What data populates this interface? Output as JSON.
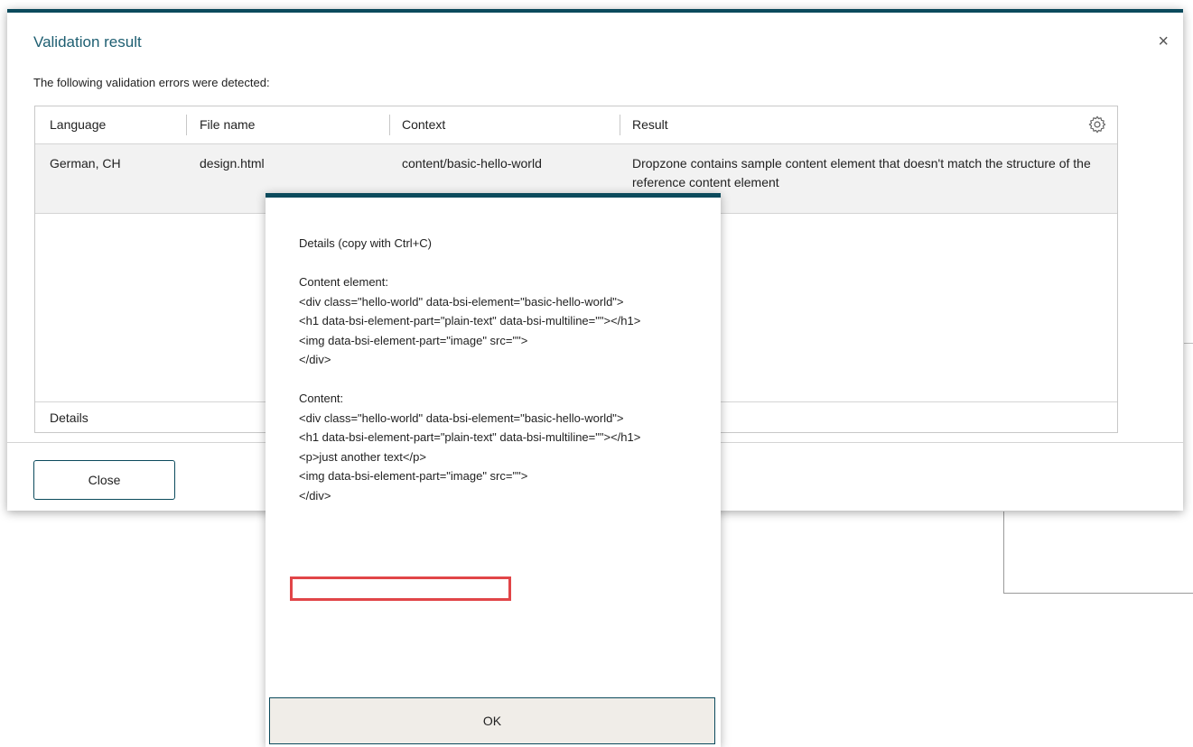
{
  "dialog": {
    "title": "Validation result",
    "close_symbol": "×",
    "intro": "The following validation errors were detected:",
    "columns": [
      "Language",
      "File name",
      "Context",
      "Result"
    ],
    "settings_icon": "gear-icon",
    "rows": [
      {
        "language": "German, CH",
        "file_name": "design.html",
        "context": "content/basic-hello-world",
        "result": "Dropzone contains sample content element that doesn't match the structure of the reference content element"
      }
    ],
    "details_label": "Details",
    "close_button": "Close"
  },
  "popup": {
    "body": "Details (copy with Ctrl+C)\n\nContent element:\n<div class=\"hello-world\" data-bsi-element=\"basic-hello-world\">\n<h1 data-bsi-element-part=\"plain-text\" data-bsi-multiline=\"\"></h1>\n<img data-bsi-element-part=\"image\" src=\"\">\n</div>\n\nContent:\n<div class=\"hello-world\" data-bsi-element=\"basic-hello-world\">\n<h1 data-bsi-element-part=\"plain-text\" data-bsi-multiline=\"\"></h1>\n<p>just another text</p>\n<img data-bsi-element-part=\"image\" src=\"\">\n</div>",
    "ok_button": "OK"
  },
  "colors": {
    "accent": "#0b4a5c",
    "title": "#1d5e71",
    "highlight": "#e14548"
  }
}
